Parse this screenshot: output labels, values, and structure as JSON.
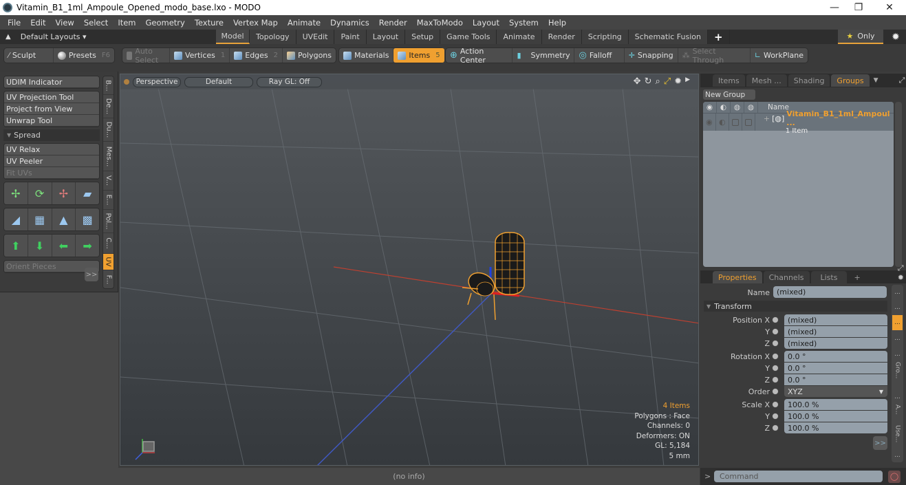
{
  "window": {
    "title": "Vitamin_B1_1ml_Ampoule_Opened_modo_base.lxo - MODO",
    "minimize": "—",
    "restore": "❐",
    "close": "✕"
  },
  "menu": [
    "File",
    "Edit",
    "View",
    "Select",
    "Item",
    "Geometry",
    "Texture",
    "Vertex Map",
    "Animate",
    "Dynamics",
    "Render",
    "MaxToModo",
    "Layout",
    "System",
    "Help"
  ],
  "layouts": {
    "label": "Default Layouts ▾",
    "tabs": [
      "Model",
      "Topology",
      "UVEdit",
      "Paint",
      "Layout",
      "Setup",
      "Game Tools",
      "Animate",
      "Render",
      "Scripting",
      "Schematic Fusion"
    ],
    "active_tab": "Model",
    "add": "+",
    "only": "Only"
  },
  "toolbar": {
    "sculpt": "Sculpt",
    "presets": "Presets",
    "presets_key": "F6",
    "auto_select": "Auto Select",
    "vertices": "Vertices",
    "vertices_key": "1",
    "edges": "Edges",
    "edges_key": "2",
    "polygons": "Polygons",
    "materials": "Materials",
    "items": "Items",
    "items_key": "5",
    "action_center": "Action Center",
    "symmetry": "Symmetry",
    "falloff": "Falloff",
    "snapping": "Snapping",
    "select_through": "Select Through",
    "workplane": "WorkPlane"
  },
  "left_panel": {
    "udim": "UDIM Indicator",
    "proj_tools": [
      "UV Projection Tool",
      "Project from View",
      "Unwrap Tool"
    ],
    "spread": "Spread",
    "relax_tools": [
      "UV Relax",
      "UV Peeler",
      "Fit UVs"
    ],
    "orient": "Orient Pieces",
    "more": ">>",
    "vtabs": [
      "B...",
      "De...",
      "Du...",
      "Mes...",
      "V...",
      "E...",
      "Pol...",
      "C...",
      "UV",
      "F..."
    ]
  },
  "viewport": {
    "view": "Perspective",
    "shading": "Default",
    "raygl": "Ray GL: Off",
    "stats": {
      "items": "4 Items",
      "polygons": "Polygons : Face",
      "channels": "Channels: 0",
      "deformers": "Deformers: ON",
      "gl": "GL: 5,184",
      "unit": "5 mm"
    }
  },
  "status": "(no info)",
  "groups_panel": {
    "tabs": [
      "Items",
      "Mesh ...",
      "Shading",
      "Groups"
    ],
    "active_tab": "Groups",
    "new_group": "New Group",
    "col_name": "Name",
    "rows": [
      {
        "name": "Vitamin_B1_1ml_Ampoul ...",
        "count": "1 Item"
      }
    ]
  },
  "properties_panel": {
    "tabs": [
      "Properties",
      "Channels",
      "Lists"
    ],
    "active_tab": "Properties",
    "add": "+",
    "name_label": "Name",
    "name_value": "(mixed)",
    "section": "Transform",
    "position": {
      "label": "Position X",
      "x": "(mixed)",
      "y": "(mixed)",
      "z": "(mixed)"
    },
    "rotation": {
      "label": "Rotation X",
      "x": "0.0 °",
      "y": "0.0 °",
      "z": "0.0 °"
    },
    "order": {
      "label": "Order",
      "value": "XYZ"
    },
    "scale": {
      "label": "Scale X",
      "x": "100.0 %",
      "y": "100.0 %",
      "z": "100.0 %"
    },
    "axis_y": "Y",
    "axis_z": "Z",
    "more": ">>",
    "side_tabs": [
      "...",
      "...",
      "...",
      "...",
      "...",
      "Gro...",
      "...",
      "A...",
      "Use...",
      "..."
    ]
  },
  "command": {
    "placeholder": "Command"
  },
  "colors": {
    "accent": "#f0a030",
    "field": "#95a0aa"
  }
}
